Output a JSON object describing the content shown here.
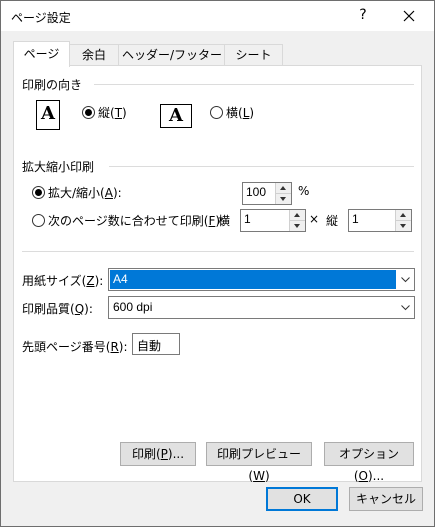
{
  "window": {
    "title": "ページ設定",
    "help_glyph": "?"
  },
  "tabs": [
    {
      "label": "ページ",
      "active": true
    },
    {
      "label": "余白",
      "active": false
    },
    {
      "label": "ヘッダー/フッター",
      "active": false
    },
    {
      "label": "シート",
      "active": false
    }
  ],
  "orientation": {
    "group_label": "印刷の向き",
    "portrait_label": "縦(",
    "portrait_key": "T",
    "landscape_label": "横(",
    "landscape_key": "L",
    "icon_glyph": "A",
    "selected": "portrait"
  },
  "scaling": {
    "group_label": "拡大縮小印刷",
    "adjust_label": "拡大/縮小(",
    "adjust_key": "A",
    "adjust_value": "100",
    "adjust_unit": "%",
    "fit_label": "次のページ数に合わせて印刷(",
    "fit_key": "F",
    "wide_label": "横",
    "wide_value": "1",
    "times": "×",
    "tall_label": "縦",
    "tall_value": "1",
    "selected": "adjust"
  },
  "paper": {
    "size_label": "用紙サイズ(",
    "size_key": "Z",
    "size_value": "A4",
    "quality_label": "印刷品質(",
    "quality_key": "Q",
    "quality_value": "600 dpi",
    "first_page_label": "先頭ページ番号(",
    "first_page_key": "R",
    "first_page_value": "自動"
  },
  "panel_buttons": {
    "print": {
      "pre": "印刷(",
      "key": "P",
      "post": ")..."
    },
    "preview": {
      "pre": "印刷プレビュー(",
      "key": "W",
      "post": ")"
    },
    "options": {
      "pre": "オプション(",
      "key": "O",
      "post": ")..."
    }
  },
  "footer": {
    "ok": "OK",
    "cancel": "キャンセル"
  },
  "colors": {
    "accent": "#0078d7",
    "panel_bg": "#ffffff",
    "dialog_bg": "#f0f0f0"
  }
}
